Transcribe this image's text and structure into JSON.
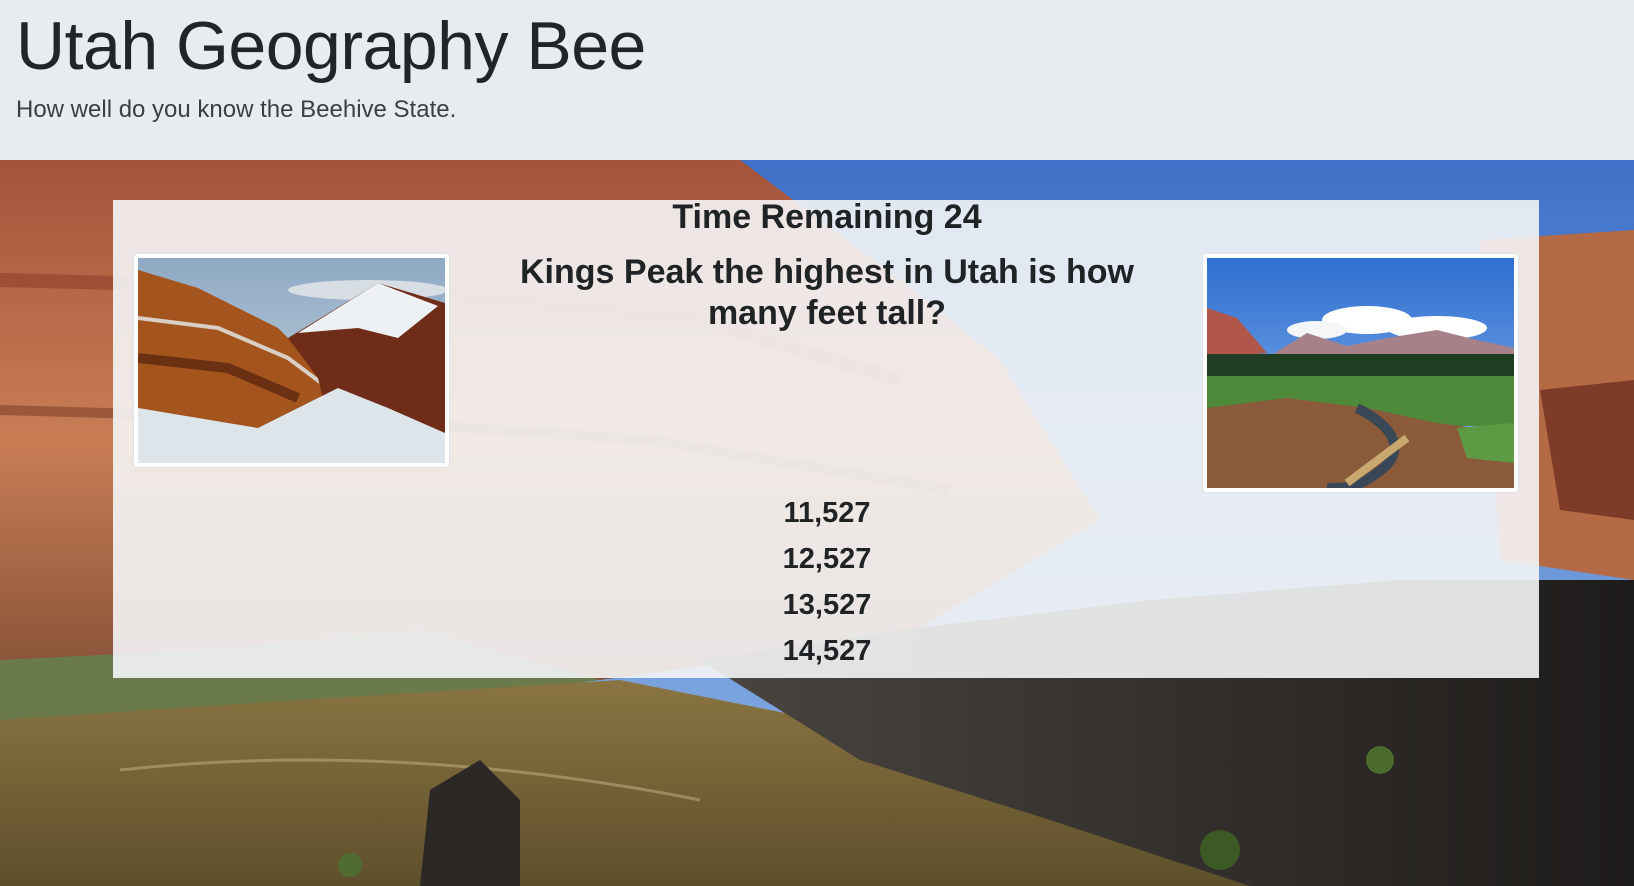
{
  "header": {
    "title": "Utah Geography Bee",
    "lead": "How well do you know the Beehive State."
  },
  "quiz": {
    "timer_label": "Time Remaining 24",
    "question": "Kings Peak the highest in Utah is how many feet tall?",
    "answers": [
      "11,527",
      "12,527",
      "13,527",
      "14,527"
    ],
    "images": [
      {
        "name": "kings-peak-mountain-image"
      },
      {
        "name": "uinta-meadow-stream-image"
      }
    ]
  }
}
